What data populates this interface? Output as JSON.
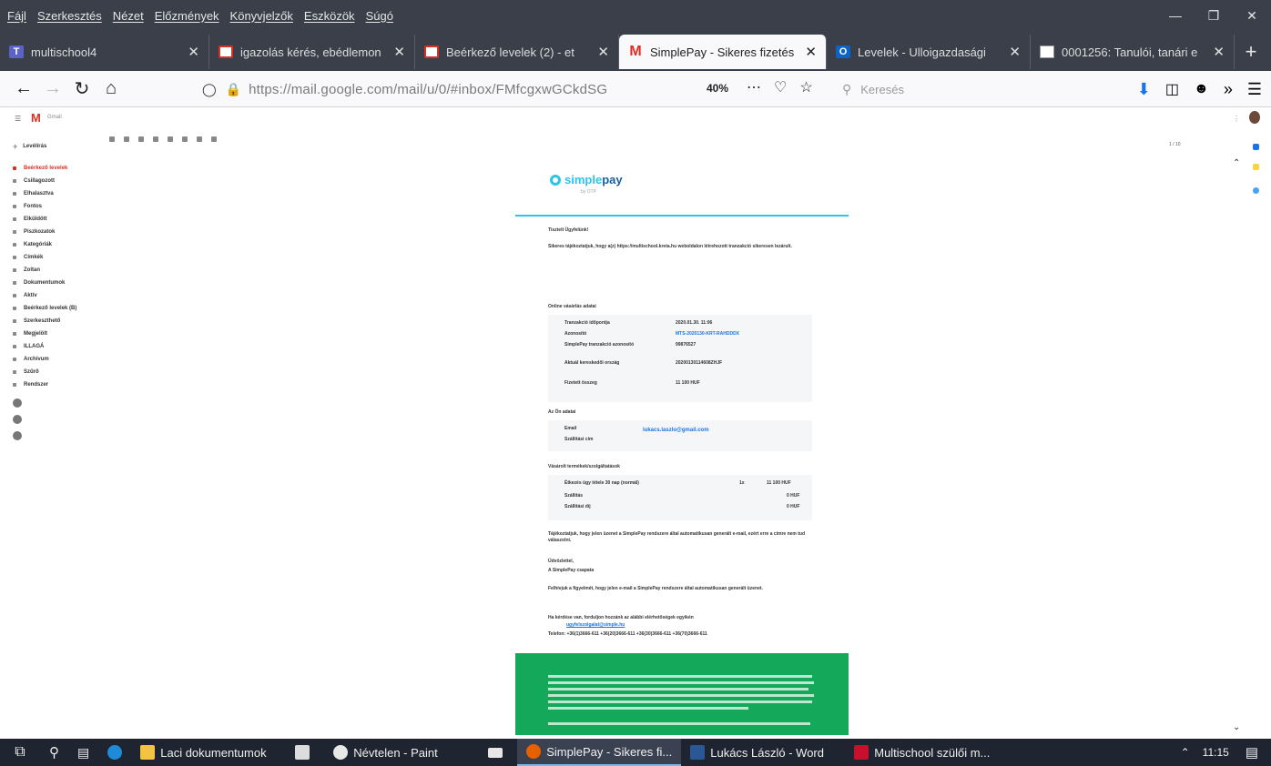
{
  "menubar": [
    "Fájl",
    "Szerkesztés",
    "Nézet",
    "Előzmények",
    "Könyvjelzők",
    "Eszközök",
    "Súgó"
  ],
  "tabs": [
    {
      "title": "multischool4",
      "icon": "teams-icon",
      "active": false
    },
    {
      "title": "igazolás kérés, ebédlemon",
      "icon": "gmail-icon",
      "active": false
    },
    {
      "title": "Beérkező levelek (2) - et",
      "icon": "gmail-icon",
      "active": false
    },
    {
      "title": "SimplePay - Sikeres fizetés",
      "icon": "gmail-icon",
      "active": true
    },
    {
      "title": "Levelek - Ulloigazdasági",
      "icon": "outlook-icon",
      "active": false
    },
    {
      "title": "0001256: Tanulói, tanári e",
      "icon": "document-icon",
      "active": false
    }
  ],
  "nav": {
    "url": "https://mail.google.com/mail/u/0/#inbox/FMfcgxwGCkdSG",
    "zoom": "40%",
    "search_placeholder": "Keresés"
  },
  "gmail": {
    "brand": "Gmail",
    "compose": "Levélírás",
    "sidebar": [
      "Beérkező levelek",
      "Csillagozott",
      "Elhalasztva",
      "Fontos",
      "Elküldött",
      "Piszkozatok",
      "Kategóriák",
      "Címkék",
      "Zoltan",
      "Dokumentumok",
      "Aktív",
      "Beérkező levelek (B)",
      "Szerkeszthető",
      "Megjelölt",
      "ILLAGÁ",
      "Archívum",
      "Szűrő",
      "Rendszer"
    ],
    "page_count": "1 / 10"
  },
  "email": {
    "logo_main": "simple",
    "logo_accent": "pay",
    "logo_sub": "by OTP",
    "greeting": "Tisztelt Ügyfelünk!",
    "intro": "Sikeres tájékoztatjuk, hogy a(z) https://multischool.kreta.hu weboldalon létrehozott tranzakció sikeresen lezárult.",
    "section_order": "Online vásárlás adatai",
    "order": [
      {
        "k": "Tranzakció időpontja",
        "v": "2020.01.30. 11:06"
      },
      {
        "k": "Azonosító",
        "v": "MTS-2020130-KRT-RAHDDDX",
        "link": true
      },
      {
        "k": "SimplePay tranzakció azonosító",
        "v": "99876527"
      },
      {
        "k": "Aktuál kereskedői ország",
        "v": "20200130114608ZHJF"
      },
      {
        "k": "Fizetett összeg",
        "v": "11 100 HUF"
      }
    ],
    "section_you": "Az Ön adatai",
    "you": [
      {
        "k": "Email",
        "v": "lukacs.laszlo@gmail.com",
        "link": true
      },
      {
        "k": "Szállítási cím",
        "v": ""
      }
    ],
    "section_items": "Vásárolt termékek/szolgáltatások",
    "items": [
      {
        "k": "Étkezés ügy tétele 30 nap (normál)",
        "q": "1x",
        "v": "11 100 HUF"
      },
      {
        "k": "Szállítás",
        "q": "",
        "v": "0 HUF"
      },
      {
        "k": "Szállítási díj",
        "q": "",
        "v": "0 HUF"
      }
    ],
    "note": "Tájékoztatjuk, hogy jelen üzenet a SimplePay rendszere által automatikusan generált e-mail, ezért erre a címre nem tud válaszolni.",
    "sign1": "Üdvözlettel,",
    "sign2": "A SimplePay csapata",
    "reminder": "Felhívjuk a figyelmét, hogy jelen e-mail a SimplePay rendszere által automatikusan generált üzenet.",
    "contact": "Ha kérdése van, forduljon hozzánk az alábbi elérhetőségek egyikén",
    "contact_email": "ugyfelszolgalat@simple.hu",
    "contact_phone": "Telefon: +36(1)3666-611 +36(20)3666-611 +36(30)3666-611 +36(70)3666-611"
  },
  "taskbar": [
    {
      "label": "Laci dokumentumok",
      "icon": "folder-icon"
    },
    {
      "label": "",
      "icon": "store-icon"
    },
    {
      "label": "Névtelen - Paint",
      "icon": "paint-icon"
    },
    {
      "label": "",
      "icon": "mail-icon"
    },
    {
      "label": "SimplePay - Sikeres fi...",
      "icon": "firefox-icon",
      "active": true
    },
    {
      "label": "Lukács László - Word",
      "icon": "word-icon"
    },
    {
      "label": "Multischool szülői m...",
      "icon": "pdf-icon"
    }
  ],
  "clock": "11:15"
}
